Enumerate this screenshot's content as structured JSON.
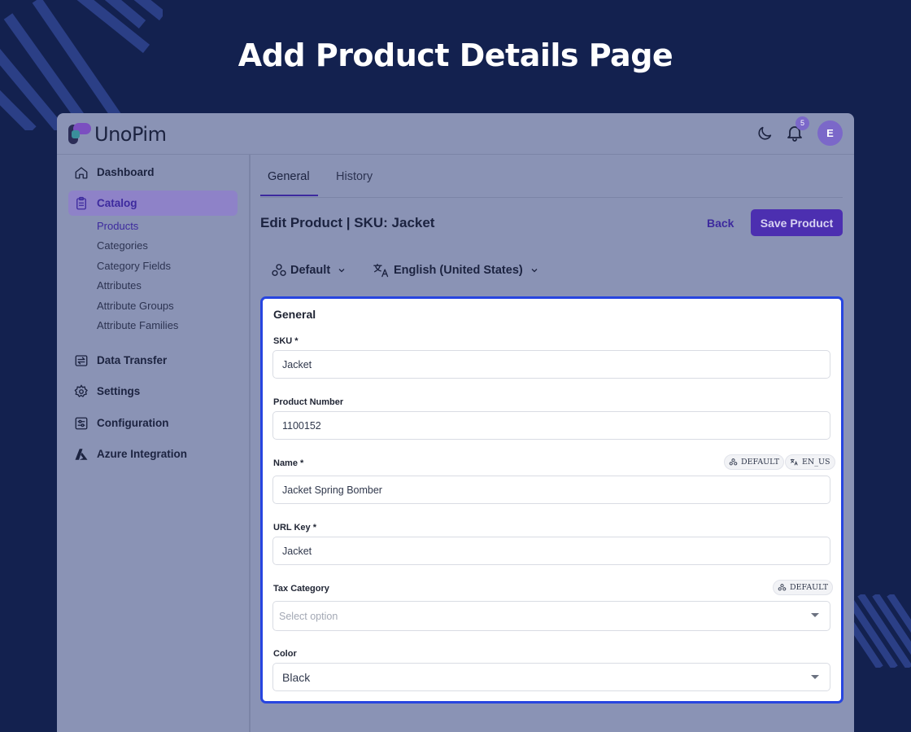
{
  "heading": "Add Product Details Page",
  "app": {
    "name": "UnoPim",
    "notification_count": "5",
    "avatar_initial": "E"
  },
  "sidebar": {
    "dashboard": "Dashboard",
    "catalog": "Catalog",
    "catalog_items": [
      "Products",
      "Categories",
      "Category Fields",
      "Attributes",
      "Attribute Groups",
      "Attribute Families"
    ],
    "data_transfer": "Data Transfer",
    "settings": "Settings",
    "configuration": "Configuration",
    "azure": "Azure Integration"
  },
  "tabs": [
    "General",
    "History"
  ],
  "page": {
    "title": "Edit Product | SKU: Jacket",
    "back": "Back",
    "save": "Save Product"
  },
  "switchers": {
    "channel": "Default",
    "locale": "English (United States)"
  },
  "form": {
    "title": "General",
    "sku": {
      "label": "SKU *",
      "value": "Jacket"
    },
    "product_number": {
      "label": "Product Number",
      "value": "1100152"
    },
    "name": {
      "label": "Name *",
      "value": "Jacket Spring Bomber",
      "channel_pill": "DEFAULT",
      "locale_pill": "EN_US"
    },
    "url_key": {
      "label": "URL Key *",
      "value": "Jacket"
    },
    "tax_category": {
      "label": "Tax Category",
      "placeholder": "Select option",
      "channel_pill": "DEFAULT"
    },
    "color": {
      "label": "Color",
      "value": "Black"
    }
  },
  "colors": {
    "background": "#13214f",
    "accent": "#4c2fb0",
    "focus": "#2745e0"
  }
}
